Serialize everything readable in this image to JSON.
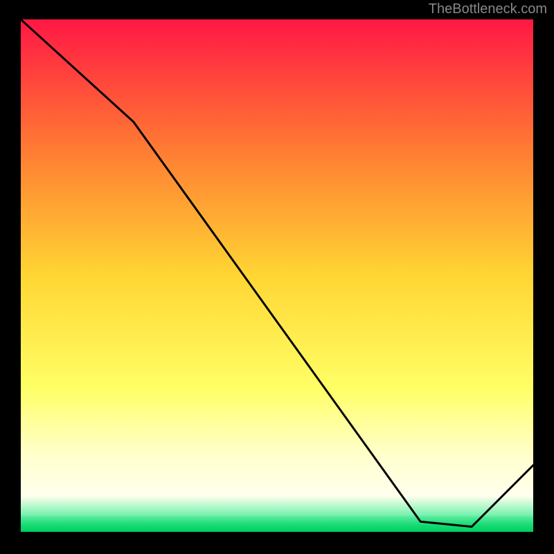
{
  "watermark": "TheBottleneck.com",
  "band_label": "",
  "chart_data": {
    "type": "line",
    "title": "",
    "xlabel": "",
    "ylabel": "",
    "xlim": [
      0,
      100
    ],
    "ylim": [
      0,
      100
    ],
    "series": [
      {
        "name": "curve",
        "x": [
          0,
          22,
          78,
          88,
          100
        ],
        "y": [
          100,
          80,
          2,
          1,
          13
        ]
      }
    ],
    "gradient_stops": [
      {
        "pos": 0,
        "color": "#ff1744"
      },
      {
        "pos": 25,
        "color": "#ff7a33"
      },
      {
        "pos": 50,
        "color": "#ffd633"
      },
      {
        "pos": 72,
        "color": "#ffff66"
      },
      {
        "pos": 85,
        "color": "#ffffcc"
      },
      {
        "pos": 93,
        "color": "#ffffee"
      },
      {
        "pos": 100,
        "color": "#00e676"
      }
    ],
    "green_band": {
      "y_from": 0,
      "y_to": 3
    }
  }
}
